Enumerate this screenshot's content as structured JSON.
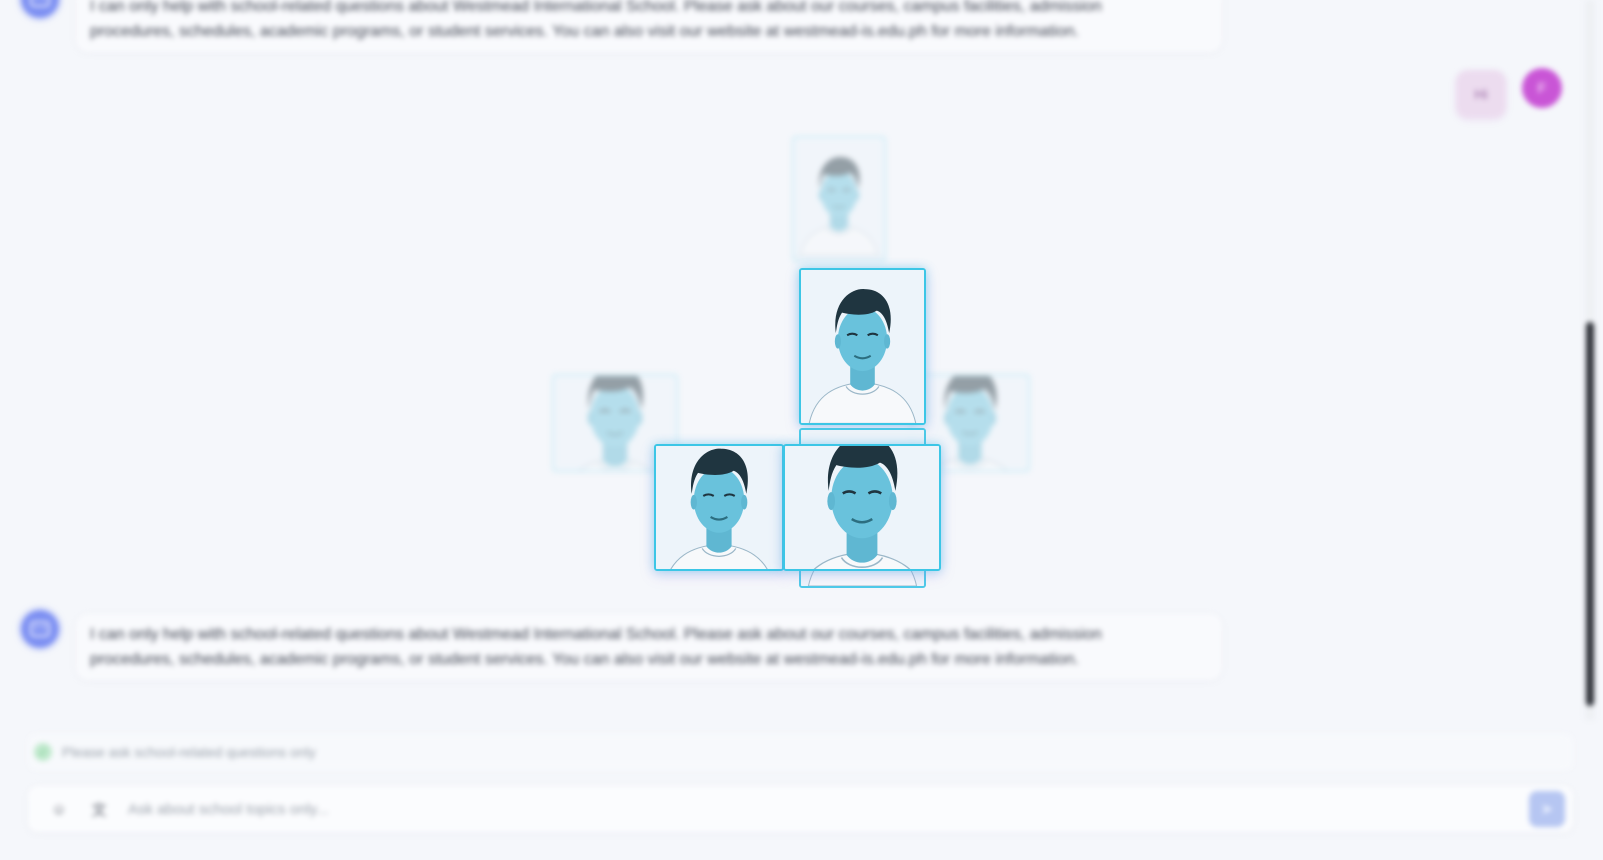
{
  "messages": {
    "top_bot": {
      "line1": "I can only help with school-related questions about Westmead International School. Please ask about our courses, campus facilities, admission",
      "line2": "procedures, schedules, academic programs, or student services. You can also visit our website at westmead-is.edu.ph for more information."
    },
    "user": {
      "text": "Hi",
      "avatar_initial": "F"
    },
    "bottom_bot": {
      "line1": "I can only help with school-related questions about Westmead International School. Please ask about our courses, campus facilities, admission",
      "line2": "procedures, schedules, academic programs, or student services. You can also visit our website at westmead-is.edu.ph for more information."
    }
  },
  "notice": {
    "text": "Please ask school-related questions only"
  },
  "composer": {
    "placeholder": "Ask about school topics only...",
    "emoji_icon": "emoji-icon",
    "translate_icon": "translate-icon",
    "send_icon": "send-icon"
  },
  "overlay": {
    "photo_cards": 7,
    "accent_color": "#3cc6e6"
  }
}
